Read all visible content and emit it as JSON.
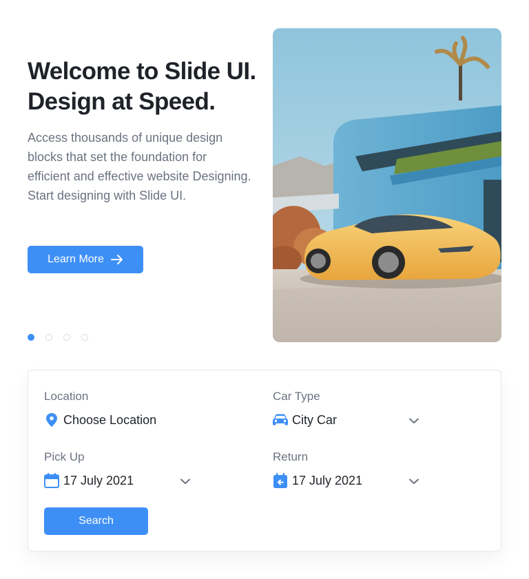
{
  "hero": {
    "title": "Welcome to Slide UI. Design at Speed.",
    "description": "Access thousands of unique design blocks that set the foundation for efficient and effective website Designing. Start designing with Slide UI.",
    "cta_label": "Learn More",
    "slides_total": 4,
    "active_slide": 1
  },
  "booking": {
    "location": {
      "label": "Location",
      "value": "Choose Location",
      "icon": "map-pin-icon"
    },
    "car_type": {
      "label": "Car Type",
      "value": "City Car",
      "icon": "car-icon"
    },
    "pick_up": {
      "label": "Pick Up",
      "value": "17 July 2021",
      "icon": "calendar-icon"
    },
    "return": {
      "label": "Return",
      "value": "17 July 2021",
      "icon": "calendar-return-icon"
    },
    "search_label": "Search"
  },
  "colors": {
    "accent": "#3e8ff5",
    "heading": "#1f2329",
    "body_text": "#6b7280",
    "border": "#e5e7eb"
  }
}
